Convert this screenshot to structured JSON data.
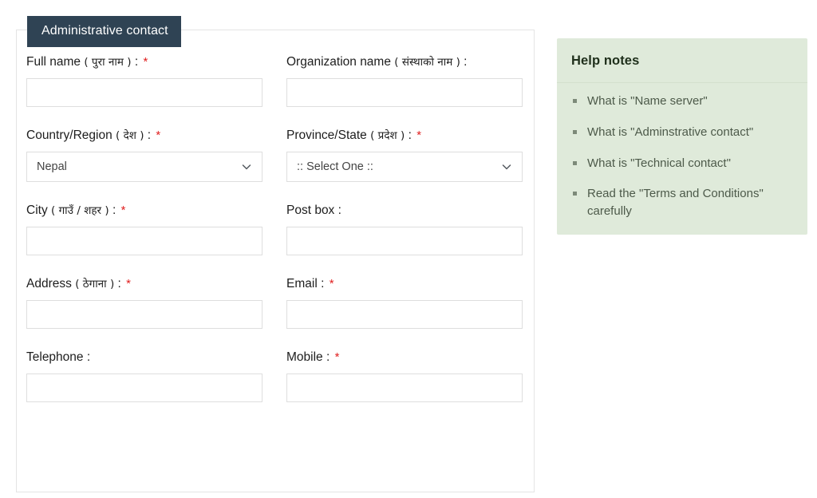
{
  "form_panel": {
    "tab_title": "Administrative contact",
    "rows": [
      {
        "left": {
          "label_en": "Full name",
          "label_np": "( पुरा नाम )",
          "colon": ":",
          "required": true,
          "control": "text",
          "value": "",
          "placeholder": ""
        },
        "right": {
          "label_en": "Organization name",
          "label_np": "( संस्थाको नाम )",
          "colon": ":",
          "required": false,
          "control": "text",
          "value": "",
          "placeholder": ""
        }
      },
      {
        "left": {
          "label_en": "Country/Region",
          "label_np": "( देश )",
          "colon": ":",
          "required": true,
          "control": "select",
          "value": "Nepal",
          "icon": "chevron-down-icon"
        },
        "right": {
          "label_en": "Province/State",
          "label_np": "( प्रदेश )",
          "colon": ":",
          "required": true,
          "control": "select",
          "value": ":: Select One ::",
          "icon": "chevron-down-icon"
        }
      },
      {
        "left": {
          "label_en": "City",
          "label_np": "( गाउँ / शहर )",
          "colon": ":",
          "required": true,
          "control": "text",
          "value": "",
          "placeholder": ""
        },
        "right": {
          "label_en": "Post box",
          "label_np": "",
          "colon": ":",
          "required": false,
          "control": "text",
          "value": "",
          "placeholder": ""
        }
      },
      {
        "left": {
          "label_en": "Address",
          "label_np": "( ठेगाना )",
          "colon": ":",
          "required": true,
          "control": "text",
          "value": "",
          "placeholder": ""
        },
        "right": {
          "label_en": "Email",
          "label_np": "",
          "colon": ":",
          "required": true,
          "control": "text",
          "value": "",
          "placeholder": ""
        }
      },
      {
        "left": {
          "label_en": "Telephone",
          "label_np": "",
          "colon": ":",
          "required": false,
          "control": "text",
          "value": "",
          "placeholder": ""
        },
        "right": {
          "label_en": "Mobile",
          "label_np": "",
          "colon": ":",
          "required": true,
          "control": "text",
          "value": "",
          "placeholder": ""
        }
      }
    ]
  },
  "help_panel": {
    "title": "Help notes",
    "items": [
      "What is \"Name server\"",
      "What is \"Adminstrative contact\"",
      "What is \"Technical contact\"",
      "Read the \"Terms and Conditions\" carefully"
    ]
  },
  "colors": {
    "tab_background": "#2f4354",
    "tab_text": "#ffffff",
    "help_background": "#dfeada",
    "help_title_text": "#20301c",
    "help_item_text": "#4d5a4a",
    "required_marker": "#e02020",
    "input_border": "#dedede",
    "panel_border": "#e4e4e4"
  }
}
